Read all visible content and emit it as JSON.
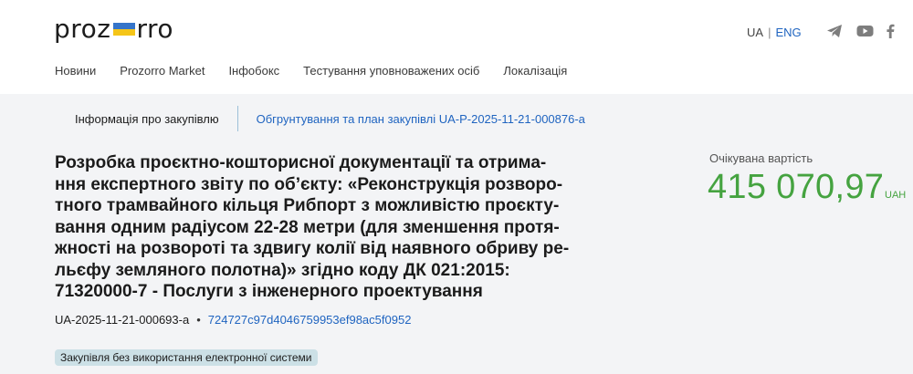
{
  "header": {
    "logo_left": "proz",
    "logo_right": "rro",
    "lang_ua": "UA",
    "lang_sep": "|",
    "lang_eng": "ENG"
  },
  "social": [
    "telegram-icon",
    "youtube-icon",
    "facebook-icon"
  ],
  "nav": {
    "items": [
      "Новини",
      "Prozorro Market",
      "Інфобокс",
      "Тестування уповноважених осіб",
      "Локалізація"
    ]
  },
  "tabs": {
    "active": "Інформація про закупівлю",
    "link": "Обгрунтування та план закупівлі UA-P-2025-11-21-000876-a"
  },
  "tender": {
    "title": "Розробка проєктно-кошторисної документації та отрима-ння експертного звіту по об’єкту: «Реконструкція розворо-тного трамвайного кільця Рибпорт з можливістю проєкту-вання одним радіусом 22-28 метри (для зменшення протя-жності на розвороті та здвигу колії від наявного обриву ре-льєфу земляного полотна)» згідно коду ДК 021:2015: 71320000-7 - Послуги з інженерного проектування",
    "title_lines": [
      "Розробка проєктно-кошторисної документації та отрима-",
      "ння експертного звіту по об’єкту: «Реконструкція розворо-",
      "тного трамвайного кільця Рибпорт з можливістю проєкту-",
      "вання одним радіусом 22-28 метри (для зменшення протя-",
      "жності на розвороті та здвигу колії від наявного обриву ре-",
      "льєфу земляного полотна)» згідно коду ДК 021:2015:",
      "71320000-7 - Послуги з інженерного проектування"
    ],
    "tender_id": "UA-2025-11-21-000693-a",
    "separator": "•",
    "hash": "724727c97d4046759953ef98ac5f0952",
    "badge": "Закупівля без використання електронної системи"
  },
  "value": {
    "label": "Очікувана вартість",
    "amount": "415 070,97",
    "currency": "UAH"
  },
  "colors": {
    "accent_blue": "#1f64c0",
    "value_green": "#45a340",
    "badge_bg": "#cce0e6",
    "page_bg": "#f3f4f6"
  }
}
